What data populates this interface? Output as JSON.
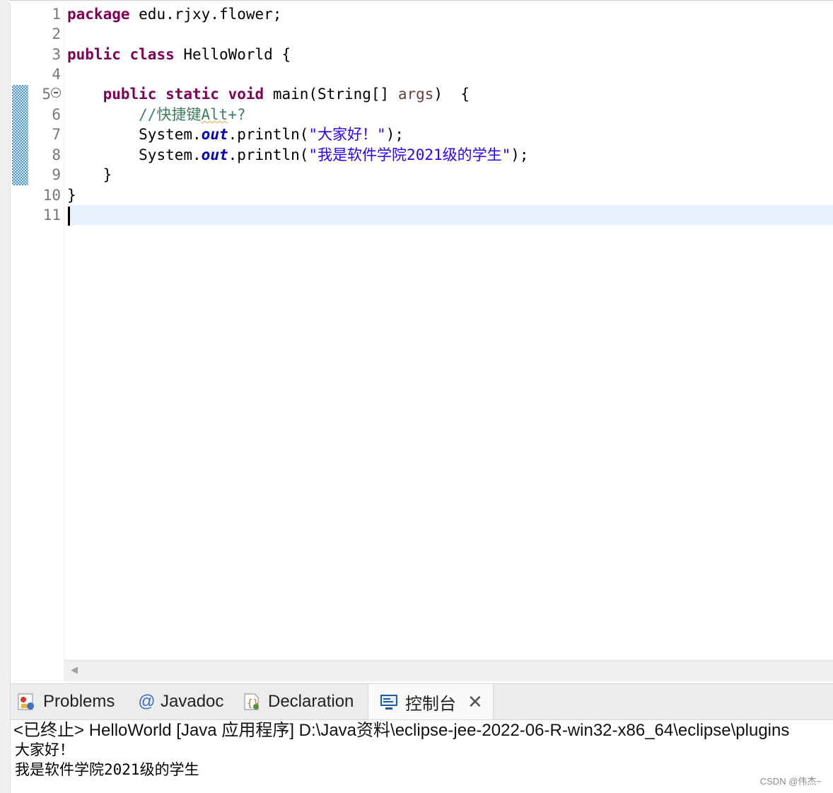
{
  "editor": {
    "line_numbers": [
      "1",
      "2",
      "3",
      "4",
      "5",
      "6",
      "7",
      "8",
      "9",
      "10",
      "11"
    ],
    "lines": [
      {
        "kw1": "package",
        "rest": " edu.rjxy.flower;"
      },
      {},
      {
        "kw1": "public",
        "kw2": "class",
        "rest": " HelloWorld {"
      },
      {},
      {
        "indent": "    ",
        "kw1": "public",
        "kw2": "static",
        "kw3": "void",
        "mid": " main(String[] ",
        "param": "args",
        "rest": ")  {"
      },
      {
        "indent": "        ",
        "comment": "//快捷键",
        "squig": "Alt",
        "comment2": "+?"
      },
      {
        "indent": "        ",
        "obj": "System.",
        "field": "out",
        "call": ".println(",
        "str": "\"大家好！\"",
        "rest": ");"
      },
      {
        "indent": "        ",
        "obj": "System.",
        "field": "out",
        "call": ".println(",
        "str": "\"我是软件学院2021级的学生\"",
        "rest": ");"
      },
      {
        "indent": "    ",
        "rest": "}"
      },
      {
        "rest": "}"
      },
      {}
    ]
  },
  "bottom_panel": {
    "tabs": {
      "problems": "Problems",
      "javadoc": "Javadoc",
      "declaration": "Declaration",
      "console": "控制台"
    },
    "icons": {
      "problems": "problems-icon",
      "javadoc": "at-sign-icon",
      "declaration": "declaration-icon",
      "console": "console-monitor-icon",
      "close": "close-icon"
    },
    "console_title": "<已终止> HelloWorld [Java 应用程序] D:\\Java资料\\eclipse-jee-2022-06-R-win32-x86_64\\eclipse\\plugins",
    "output": [
      "大家好！",
      "我是软件学院2021级的学生"
    ]
  },
  "watermark": "CSDN @伟杰~",
  "colors": {
    "keyword": "#7f0055",
    "string": "#2a00ff",
    "comment": "#3f7f5f",
    "static_field": "#0000c0",
    "current_line": "#e8f2fe"
  }
}
